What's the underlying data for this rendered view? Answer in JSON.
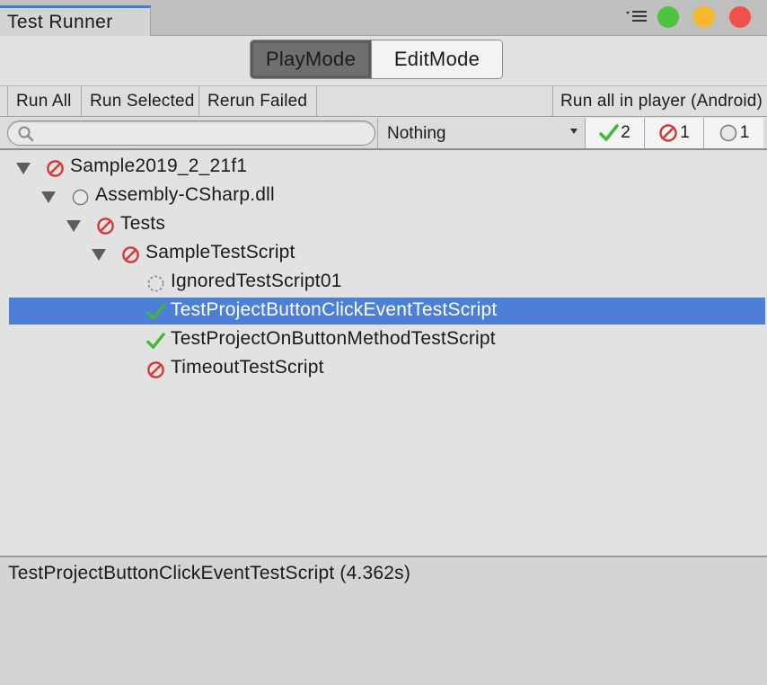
{
  "window": {
    "tab_title": "Test Runner",
    "controls": [
      "green",
      "yellow",
      "red"
    ],
    "colors": {
      "green": "#4cc43e",
      "yellow": "#f7b82e",
      "red": "#f2504a"
    }
  },
  "mode_switch": {
    "play_mode": "PlayMode",
    "edit_mode": "EditMode",
    "selected": "PlayMode"
  },
  "toolbar": {
    "run_all": "Run All",
    "run_selected": "Run Selected",
    "rerun_failed": "Rerun Failed",
    "run_in_player": "Run all in player (Android)"
  },
  "filter": {
    "search_placeholder": "",
    "category_selected": "Nothing",
    "passed_count": "2",
    "failed_count": "1",
    "notrun_count": "1"
  },
  "tree": [
    {
      "label": "Sample2019_2_21f1",
      "status": "failed",
      "expanded": true,
      "depth": 0
    },
    {
      "label": "Assembly-CSharp.dll",
      "status": "notrun",
      "expanded": true,
      "depth": 1
    },
    {
      "label": "Tests",
      "status": "failed",
      "expanded": true,
      "depth": 2
    },
    {
      "label": "SampleTestScript",
      "status": "failed",
      "expanded": true,
      "depth": 3
    },
    {
      "label": "IgnoredTestScript01",
      "status": "ignored",
      "depth": 4
    },
    {
      "label": "TestProjectButtonClickEventTestScript",
      "status": "passed",
      "depth": 4,
      "selected": true
    },
    {
      "label": "TestProjectOnButtonMethodTestScript",
      "status": "passed",
      "depth": 4
    },
    {
      "label": "TimeoutTestScript",
      "status": "failed",
      "depth": 4
    }
  ],
  "detail": {
    "text": "TestProjectButtonClickEventTestScript (4.362s)"
  },
  "colors": {
    "selection": "#4c80d8",
    "pass": "#3fb833",
    "fail": "#d23a3a",
    "tab_accent": "#3f7cd8"
  }
}
